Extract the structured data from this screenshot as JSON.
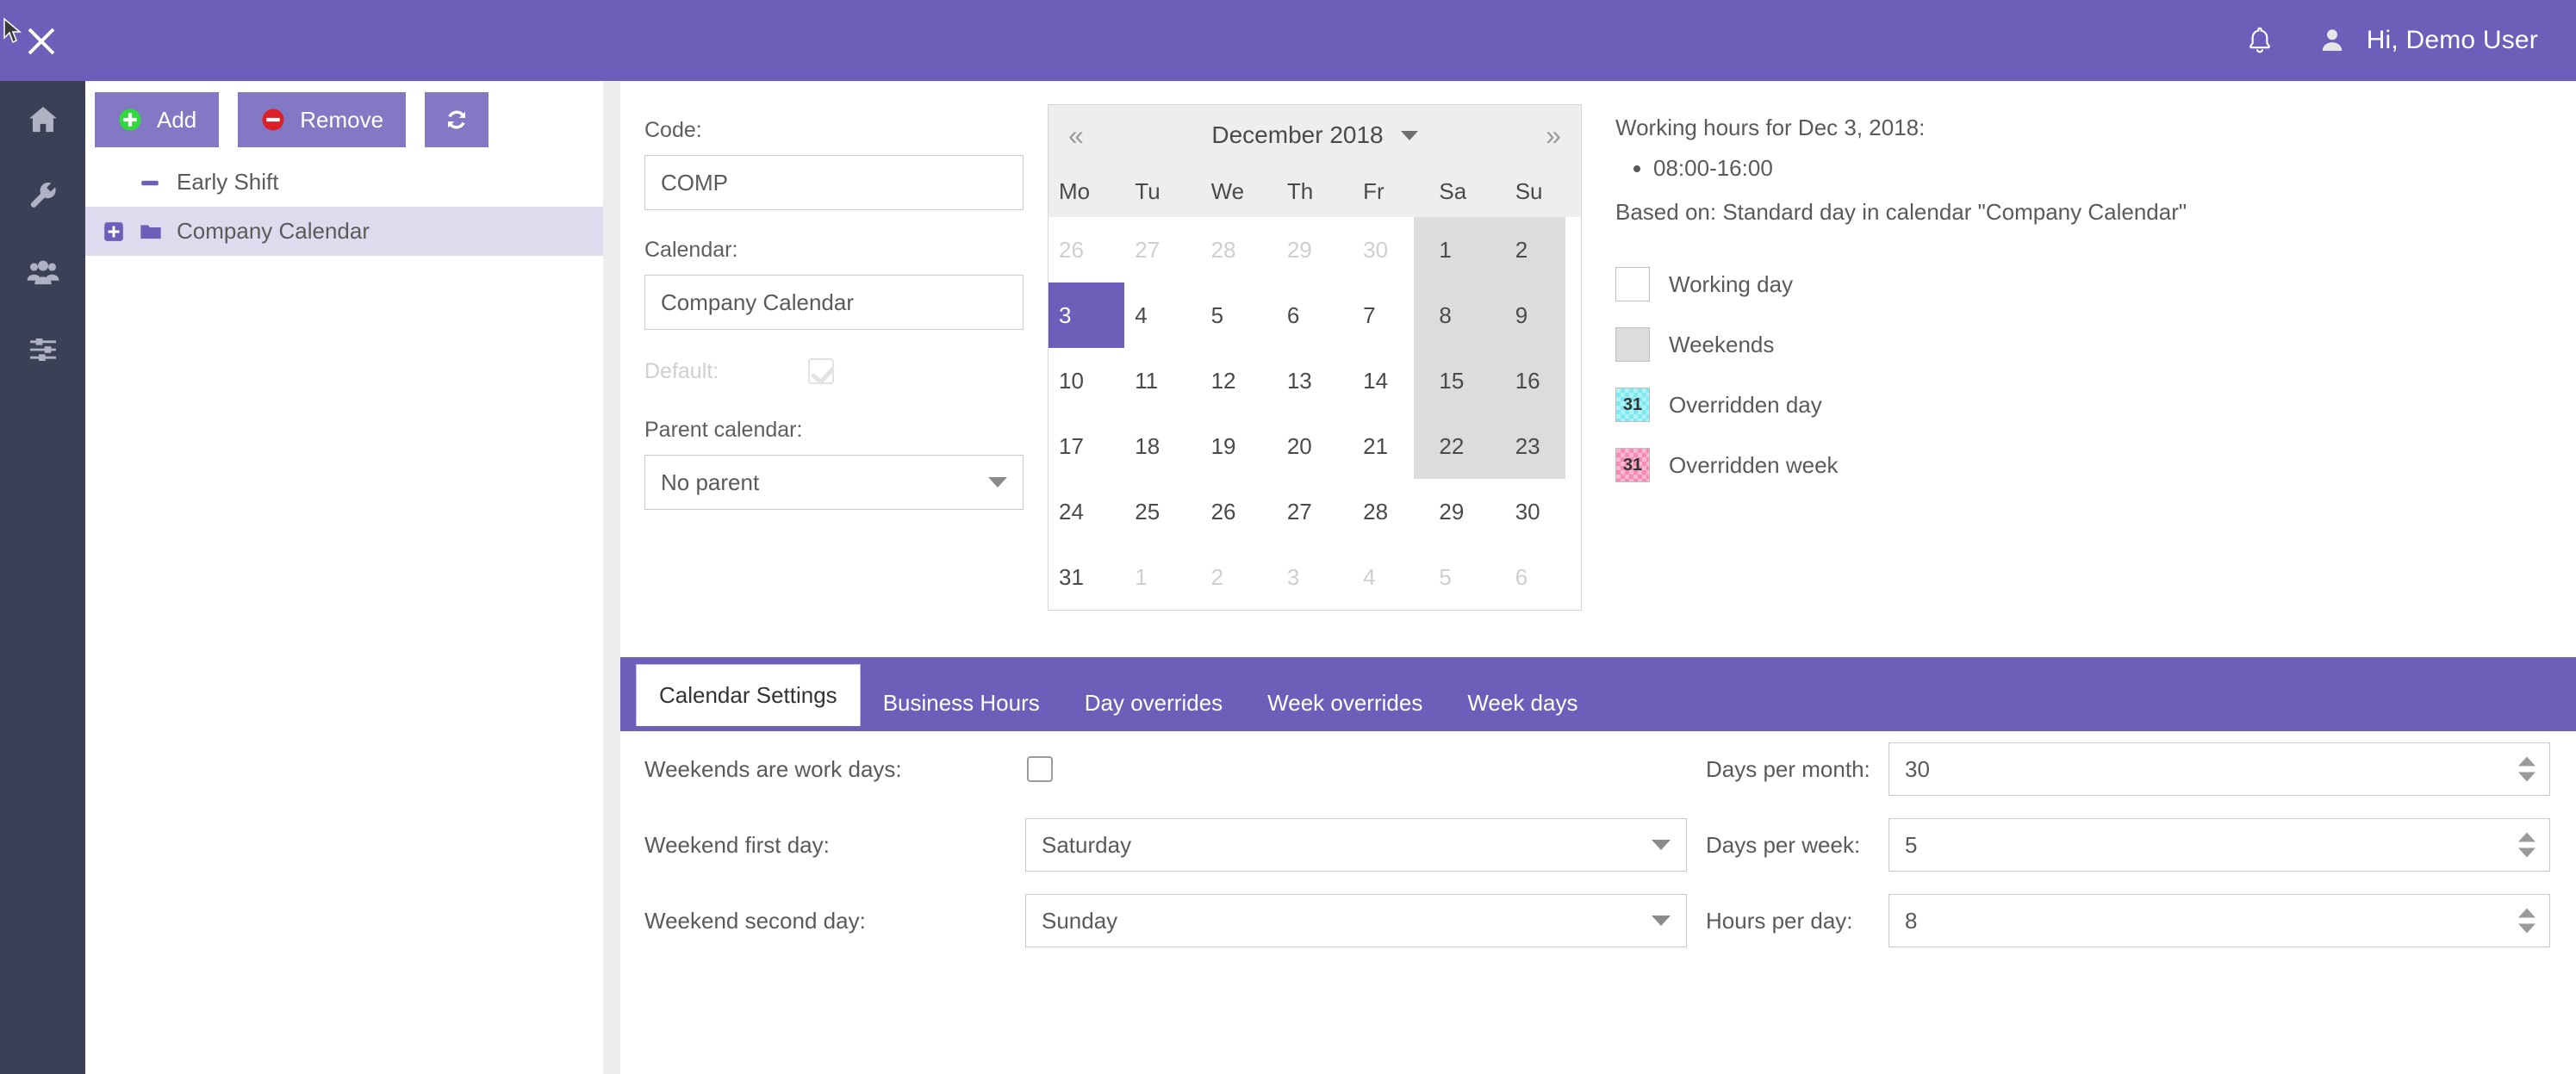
{
  "topbar": {
    "close_icon": "close-icon",
    "bell_icon": "bell-icon",
    "avatar_icon": "user-avatar-icon",
    "greeting": "Hi, Demo User"
  },
  "rail": {
    "items": [
      {
        "icon": "home-icon",
        "name": "home"
      },
      {
        "icon": "wrench-icon",
        "name": "tools"
      },
      {
        "icon": "users-icon",
        "name": "users"
      },
      {
        "icon": "sliders-icon",
        "name": "settings"
      }
    ]
  },
  "tree": {
    "toolbar": {
      "add_label": "Add",
      "remove_label": "Remove",
      "refresh_icon": "refresh-icon",
      "add_icon": "plus-circle-icon",
      "remove_icon": "minus-circle-icon"
    },
    "items": [
      {
        "label": "Early Shift",
        "icon": "dash-icon",
        "selected": false,
        "expandable": false
      },
      {
        "label": "Company Calendar",
        "icon": "folder-icon",
        "selected": true,
        "expandable": true
      }
    ]
  },
  "form": {
    "code_label": "Code:",
    "code_value": "COMP",
    "calendar_label": "Calendar:",
    "calendar_value": "Company Calendar",
    "default_label": "Default:",
    "default_checked": true,
    "parent_label": "Parent calendar:",
    "parent_value": "No parent"
  },
  "calendar": {
    "prev_label": "«",
    "next_label": "»",
    "title": "December 2018",
    "dows": [
      "Mo",
      "Tu",
      "We",
      "Th",
      "Fr",
      "Sa",
      "Su"
    ],
    "weeks": [
      [
        {
          "d": "26",
          "muted": true
        },
        {
          "d": "27",
          "muted": true
        },
        {
          "d": "28",
          "muted": true
        },
        {
          "d": "29",
          "muted": true
        },
        {
          "d": "30",
          "muted": true
        },
        {
          "d": "1"
        },
        {
          "d": "2"
        }
      ],
      [
        {
          "d": "3",
          "selected": true
        },
        {
          "d": "4"
        },
        {
          "d": "5"
        },
        {
          "d": "6"
        },
        {
          "d": "7"
        },
        {
          "d": "8"
        },
        {
          "d": "9"
        }
      ],
      [
        {
          "d": "10"
        },
        {
          "d": "11"
        },
        {
          "d": "12"
        },
        {
          "d": "13"
        },
        {
          "d": "14"
        },
        {
          "d": "15"
        },
        {
          "d": "16"
        }
      ],
      [
        {
          "d": "17"
        },
        {
          "d": "18"
        },
        {
          "d": "19"
        },
        {
          "d": "20"
        },
        {
          "d": "21"
        },
        {
          "d": "22"
        },
        {
          "d": "23"
        }
      ],
      [
        {
          "d": "24"
        },
        {
          "d": "25"
        },
        {
          "d": "26"
        },
        {
          "d": "27"
        },
        {
          "d": "28"
        },
        {
          "d": "29"
        },
        {
          "d": "30"
        }
      ],
      [
        {
          "d": "31"
        },
        {
          "d": "1",
          "muted": true
        },
        {
          "d": "2",
          "muted": true
        },
        {
          "d": "3",
          "muted": true
        },
        {
          "d": "4",
          "muted": true
        },
        {
          "d": "5",
          "muted": true
        },
        {
          "d": "6",
          "muted": true
        }
      ]
    ]
  },
  "info": {
    "title": "Working hours for Dec 3, 2018:",
    "hours": [
      "08:00-16:00"
    ],
    "based_on": "Based on: Standard day in calendar \"Company Calendar\""
  },
  "legend": [
    {
      "label": "Working day",
      "swatch": "sw-working",
      "text": ""
    },
    {
      "label": "Weekends",
      "swatch": "sw-weekend",
      "text": ""
    },
    {
      "label": "Overridden day",
      "swatch": "sw-oday",
      "text": "31"
    },
    {
      "label": "Overridden week",
      "swatch": "sw-oweek",
      "text": "31"
    }
  ],
  "tabs": [
    {
      "label": "Calendar Settings",
      "active": true
    },
    {
      "label": "Business Hours",
      "active": false
    },
    {
      "label": "Day overrides",
      "active": false
    },
    {
      "label": "Week overrides",
      "active": false
    },
    {
      "label": "Week days",
      "active": false
    }
  ],
  "settings": {
    "weekends_work_label": "Weekends are work days:",
    "weekends_work_checked": false,
    "weekend_first_label": "Weekend first day:",
    "weekend_first_value": "Saturday",
    "weekend_second_label": "Weekend second day:",
    "weekend_second_value": "Sunday",
    "days_per_month_label": "Days per month:",
    "days_per_month_value": "30",
    "days_per_week_label": "Days per week:",
    "days_per_week_value": "5",
    "hours_per_day_label": "Hours per day:",
    "hours_per_day_value": "8"
  },
  "colors": {
    "header_purple": "#6b5fb9",
    "button_purple": "#8378c4",
    "rail_dark": "#3b4056",
    "tree_selected": "#dedbef"
  }
}
